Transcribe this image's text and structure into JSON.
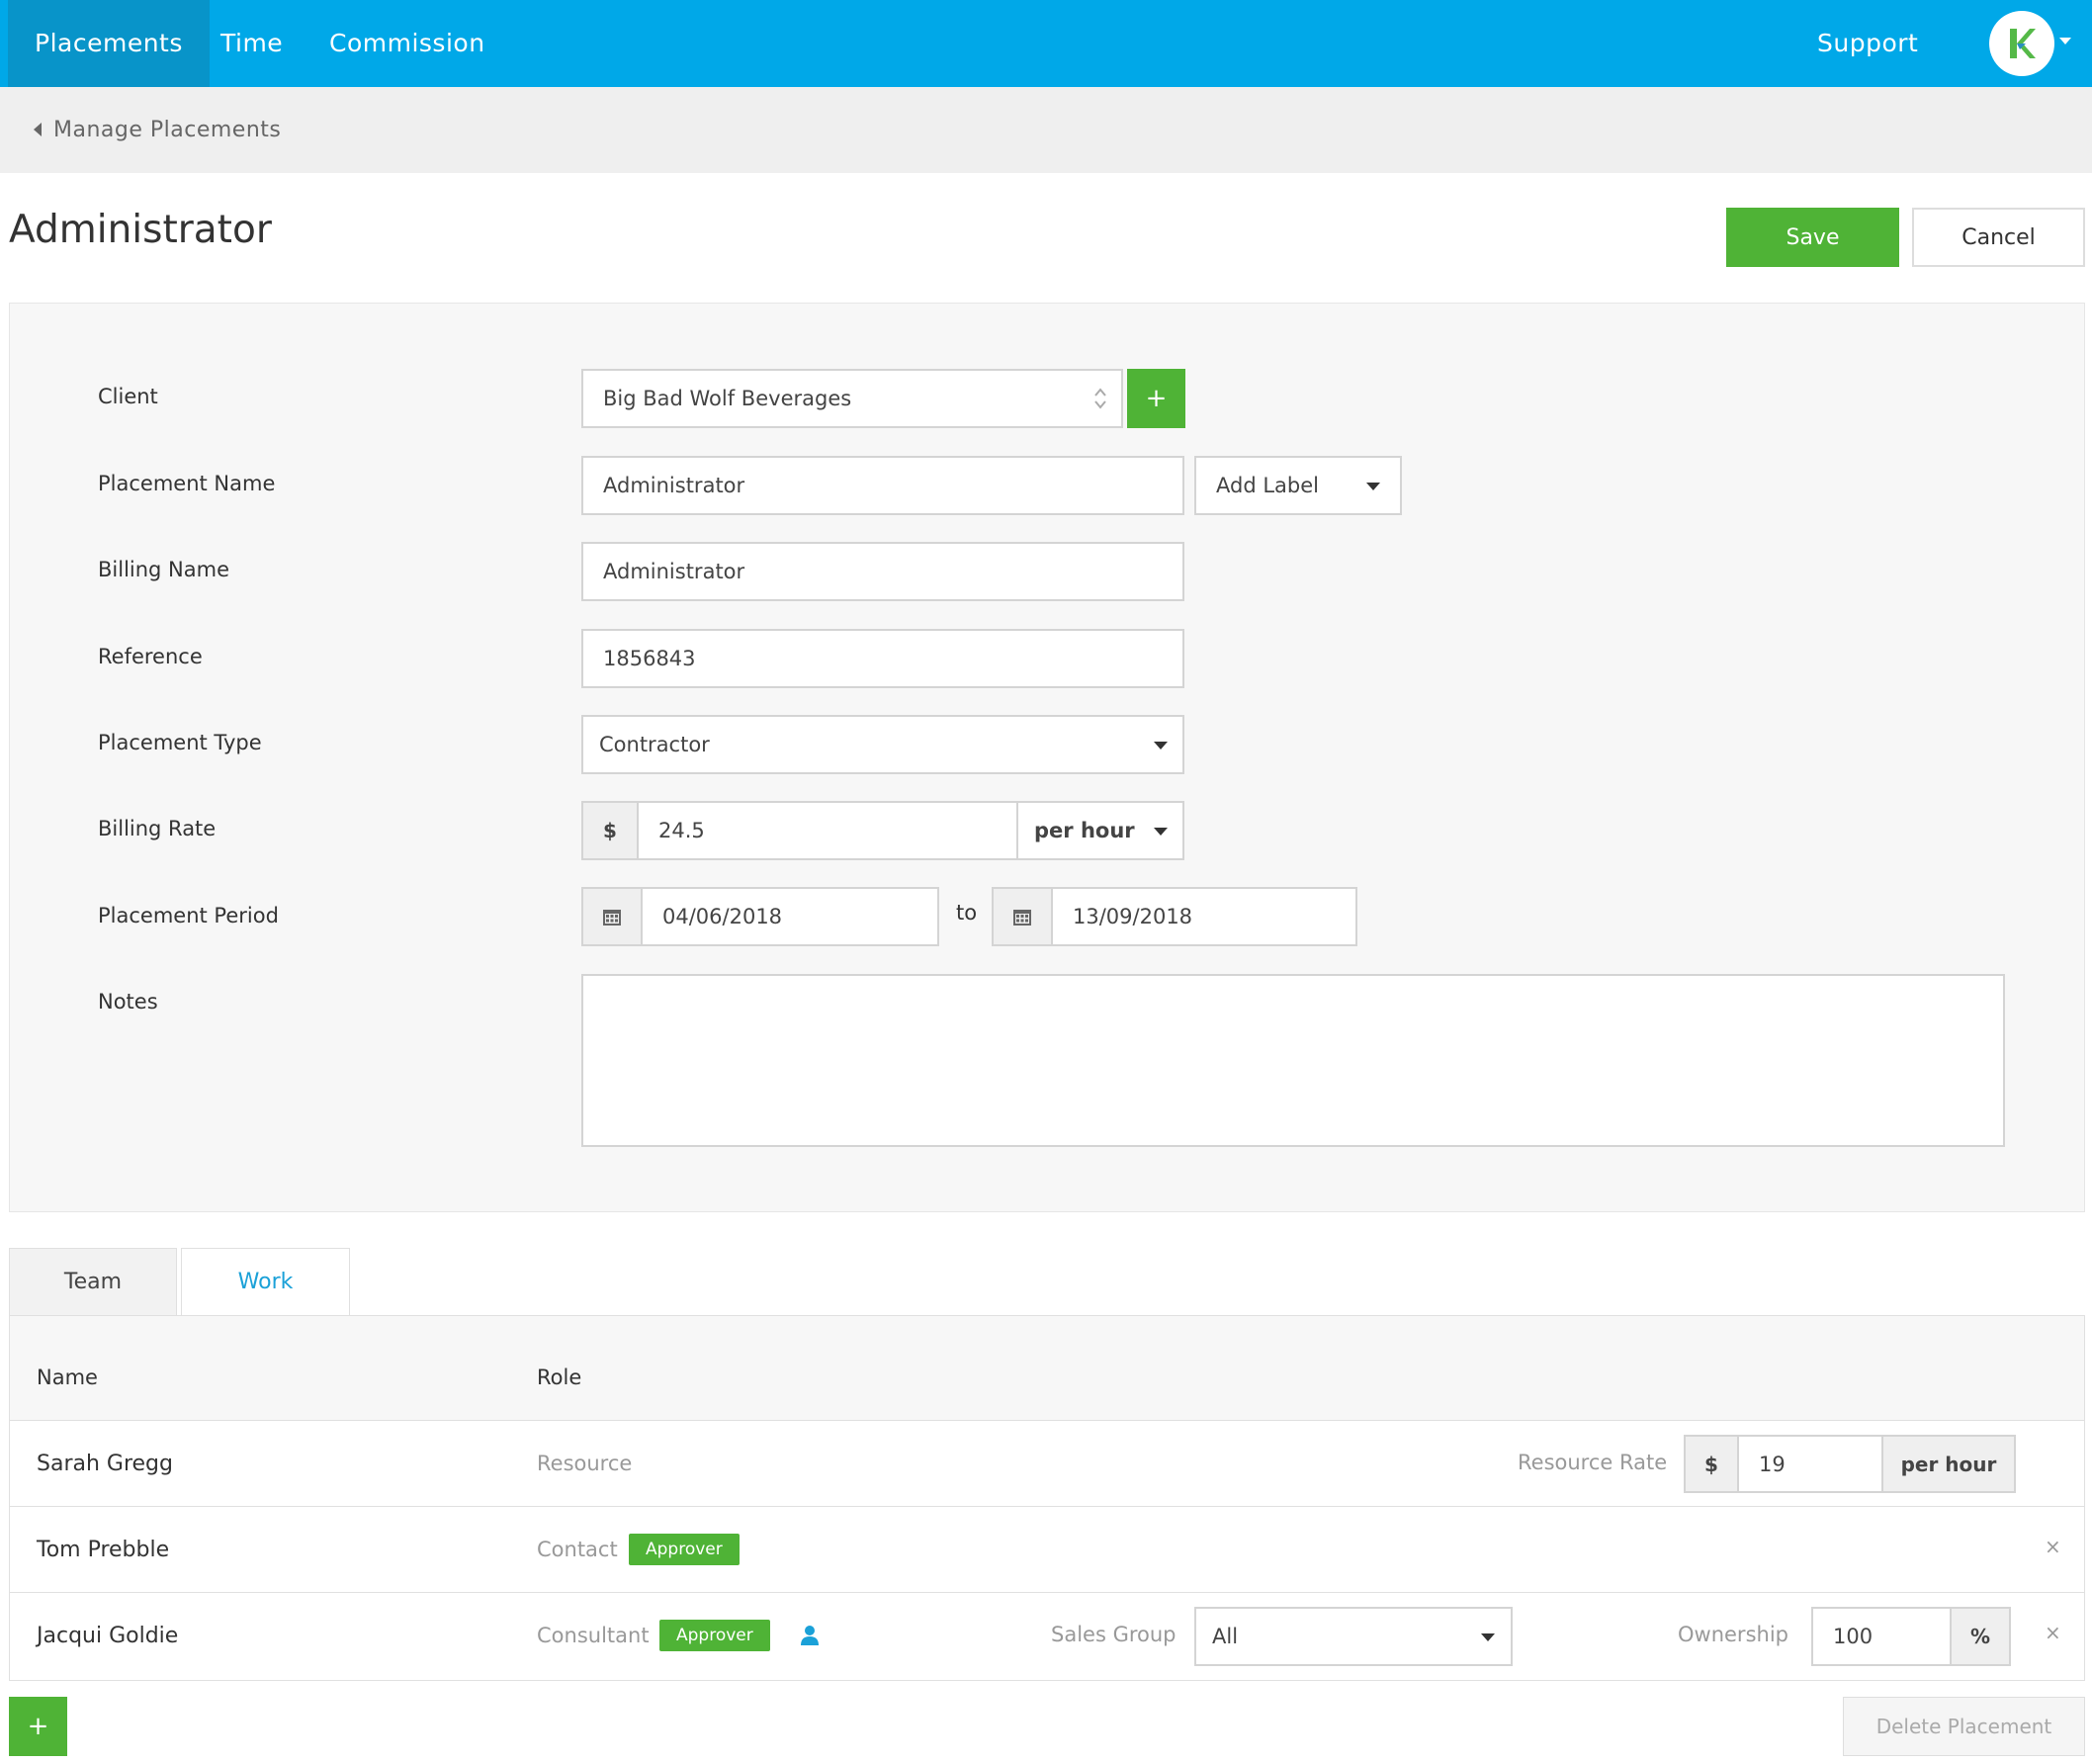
{
  "nav": {
    "items": [
      {
        "label": "Placements",
        "active": true
      },
      {
        "label": "Time",
        "active": false
      },
      {
        "label": "Commission",
        "active": false
      }
    ],
    "support_label": "Support",
    "avatar_letter": "K",
    "brand_color": "#00a8e8",
    "accent_green": "#4fb336"
  },
  "breadcrumb": {
    "label": "Manage Placements"
  },
  "page": {
    "title": "Administrator",
    "save_label": "Save",
    "cancel_label": "Cancel"
  },
  "form": {
    "client": {
      "label": "Client",
      "value": "Big Bad Wolf Beverages",
      "add_icon": "+"
    },
    "placement_name": {
      "label": "Placement Name",
      "value": "Administrator",
      "add_label": "Add Label"
    },
    "billing_name": {
      "label": "Billing Name",
      "value": "Administrator"
    },
    "reference": {
      "label": "Reference",
      "value": "1856843"
    },
    "placement_type": {
      "label": "Placement Type",
      "value": "Contractor"
    },
    "billing_rate": {
      "label": "Billing Rate",
      "currency": "$",
      "value": "24.5",
      "unit": "per hour"
    },
    "placement_period": {
      "label": "Placement Period",
      "start": "04/06/2018",
      "to_label": "to",
      "end": "13/09/2018"
    },
    "notes": {
      "label": "Notes",
      "value": ""
    }
  },
  "tabs": [
    {
      "label": "Team",
      "active": true
    },
    {
      "label": "Work",
      "active": false
    }
  ],
  "team_table": {
    "headers": {
      "name": "Name",
      "role": "Role"
    },
    "rows": [
      {
        "name": "Sarah Gregg",
        "role": "Resource",
        "rate_label": "Resource Rate",
        "currency": "$",
        "rate": "19",
        "unit": "per hour"
      },
      {
        "name": "Tom Prebble",
        "role": "Contact",
        "badge": "Approver",
        "remove": "×"
      },
      {
        "name": "Jacqui Goldie",
        "role": "Consultant",
        "badge": "Approver",
        "sales_group_label": "Sales Group",
        "sales_group": "All",
        "ownership_label": "Ownership",
        "ownership": "100",
        "ownership_unit": "%",
        "remove": "×"
      }
    ]
  },
  "footer": {
    "add_icon": "+",
    "delete_label": "Delete Placement"
  }
}
